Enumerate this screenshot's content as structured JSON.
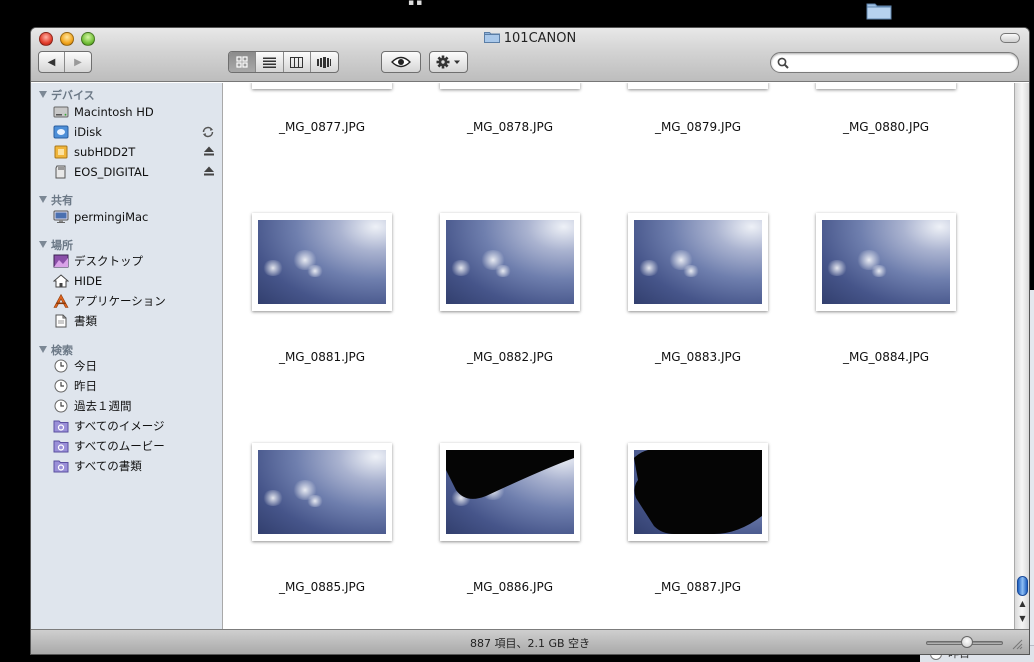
{
  "window": {
    "title": "101CANON"
  },
  "toolbar": {
    "back_label": "◀",
    "forward_label": "▶",
    "search_placeholder": "",
    "search_value": ""
  },
  "sidebar": {
    "sections": [
      {
        "header": "デバイス",
        "items": [
          {
            "label": "Macintosh HD",
            "icon": "hard-drive-icon"
          },
          {
            "label": "iDisk",
            "icon": "idisk-icon",
            "right_icon": "sync-icon"
          },
          {
            "label": "subHDD2T",
            "icon": "external-drive-icon",
            "right_icon": "eject-icon"
          },
          {
            "label": "EOS_DIGITAL",
            "icon": "sd-card-icon",
            "right_icon": "eject-icon"
          }
        ]
      },
      {
        "header": "共有",
        "items": [
          {
            "label": "permingiMac",
            "icon": "imac-icon"
          }
        ]
      },
      {
        "header": "場所",
        "items": [
          {
            "label": "デスクトップ",
            "icon": "desktop-icon"
          },
          {
            "label": "HIDE",
            "icon": "home-icon"
          },
          {
            "label": "アプリケーション",
            "icon": "applications-icon"
          },
          {
            "label": "書類",
            "icon": "documents-icon"
          }
        ]
      },
      {
        "header": "検索",
        "items": [
          {
            "label": "今日",
            "icon": "clock-icon"
          },
          {
            "label": "昨日",
            "icon": "clock-icon"
          },
          {
            "label": "過去１週間",
            "icon": "clock-icon"
          },
          {
            "label": "すべてのイメージ",
            "icon": "smart-folder-icon"
          },
          {
            "label": "すべてのムービー",
            "icon": "smart-folder-icon"
          },
          {
            "label": "すべての書類",
            "icon": "smart-folder-icon"
          }
        ]
      }
    ]
  },
  "files": {
    "row0": [
      "_MG_0877.JPG",
      "_MG_0878.JPG",
      "_MG_0879.JPG",
      "_MG_0880.JPG"
    ],
    "row1": [
      "_MG_0881.JPG",
      "_MG_0882.JPG",
      "_MG_0883.JPG",
      "_MG_0884.JPG"
    ],
    "row2": [
      "_MG_0885.JPG",
      "_MG_0886.JPG",
      "_MG_0887.JPG"
    ]
  },
  "status": {
    "text": "887 項目、2.1 GB 空き"
  },
  "background_window": {
    "item_label": "昨日"
  }
}
